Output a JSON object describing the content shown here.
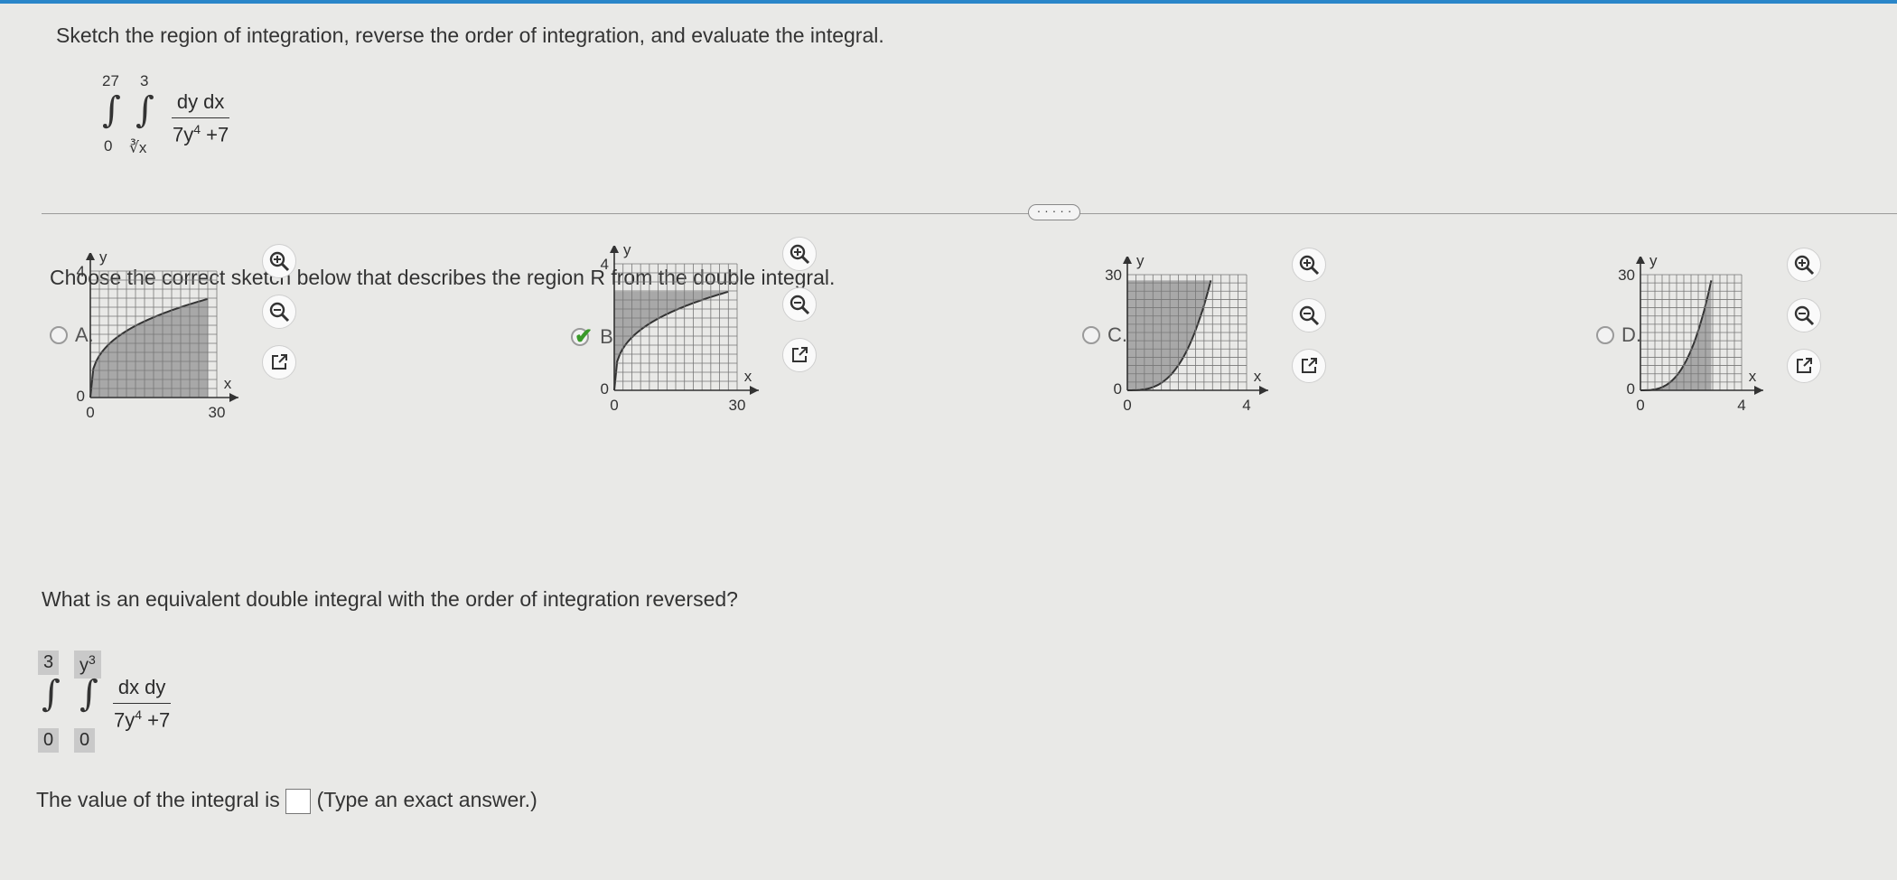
{
  "question": {
    "prompt": "Sketch the region of integration, reverse the order of integration, and evaluate the integral.",
    "integral": {
      "outer_upper": "27",
      "outer_lower": "0",
      "inner_upper": "3",
      "inner_lower": "∛x",
      "numerator": "dy dx",
      "denominator_base": "7y",
      "denominator_exp": "4",
      "denominator_tail": "+7"
    }
  },
  "more_button": "· · · · ·",
  "part1": {
    "prompt": "Choose the correct sketch below that describes the region R from the double integral."
  },
  "options": [
    {
      "label": "A.",
      "y_tick": "4",
      "x_tick": "30",
      "origin_x": "0",
      "origin_y": "0",
      "xlabel": "x",
      "ylabel": "y",
      "selected": false
    },
    {
      "label": "B.",
      "y_tick": "4",
      "x_tick": "30",
      "origin_x": "0",
      "origin_y": "0",
      "xlabel": "x",
      "ylabel": "y",
      "selected": true
    },
    {
      "label": "C.",
      "y_tick": "30",
      "x_tick": "4",
      "origin_x": "0",
      "origin_y": "0",
      "xlabel": "x",
      "ylabel": "y",
      "selected": false
    },
    {
      "label": "D.",
      "y_tick": "30",
      "x_tick": "4",
      "origin_x": "0",
      "origin_y": "0",
      "xlabel": "x",
      "ylabel": "y",
      "selected": false
    }
  ],
  "part2": {
    "prompt": "What is an equivalent double integral with the order of integration reversed?",
    "integral": {
      "outer_upper": "3",
      "outer_lower": "0",
      "inner_upper": "y",
      "inner_upper_exp": "3",
      "inner_lower": "0",
      "numerator": "dx dy",
      "denominator_base": "7y",
      "denominator_exp": "4",
      "denominator_tail": "+7"
    }
  },
  "part3": {
    "prompt_before": "The value of the integral is",
    "prompt_after": "(Type an exact answer.)",
    "answer": ""
  },
  "colors": {
    "check": "#3a9a2a",
    "shade": "#a8a8a8",
    "topbar": "#2a86c9"
  },
  "icons": [
    "zoom-in-icon",
    "zoom-out-icon",
    "open-new-window-icon",
    "checkmark-icon"
  ]
}
